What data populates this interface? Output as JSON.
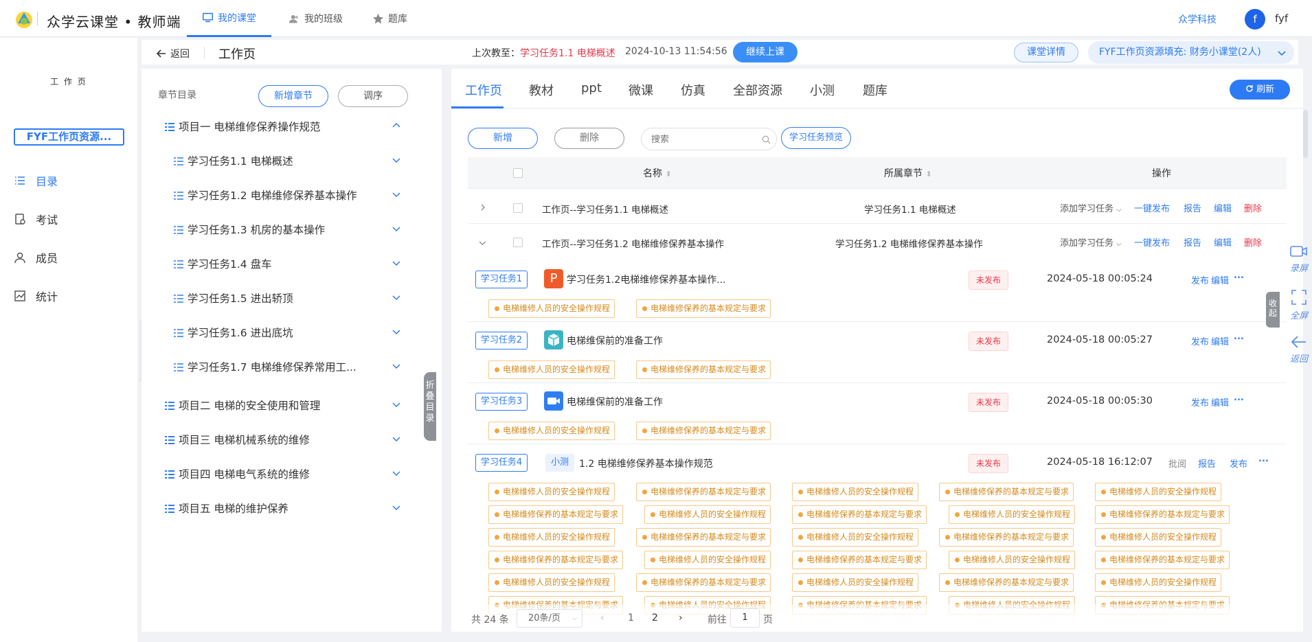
{
  "topbar": {
    "brand": "众学云课堂 • 教师端",
    "nav": [
      "我的课堂",
      "我的班级",
      "题库"
    ],
    "company_link": "众学科技",
    "avatar_letter": "f",
    "username": "fyf"
  },
  "leftnav": {
    "cover_text": "工 作 页",
    "course_name": "FYF工作页资源...",
    "items": [
      "目录",
      "考试",
      "成员",
      "统计"
    ]
  },
  "subheader": {
    "back_label": "返回",
    "page_title": "工作页",
    "last_taught_prefix": "上次教至：",
    "last_taught_task": "学习任务1.1 电梯概述",
    "last_taught_time": "2024-10-13 11:54:56",
    "continue_button": "继续上课",
    "class_detail_button": "课堂详情",
    "course_select": "FYF工作页资源填充:   财务小课堂(2人)"
  },
  "toc": {
    "title": "章节目录",
    "add_chapter": "新增章节",
    "reorder": "调序",
    "collapse_label": "折叠目录",
    "items": [
      {
        "label": "项目一 电梯维修保养操作规范",
        "level": 1,
        "expanded": true
      },
      {
        "label": "学习任务1.1 电梯概述",
        "level": 2
      },
      {
        "label": "学习任务1.2 电梯维修保养基本操作",
        "level": 2
      },
      {
        "label": "学习任务1.3 机房的基本操作",
        "level": 2
      },
      {
        "label": "学习任务1.4 盘车",
        "level": 2
      },
      {
        "label": "学习任务1.5 进出轿顶",
        "level": 2
      },
      {
        "label": "学习任务1.6 进出底坑",
        "level": 2
      },
      {
        "label": "学习任务1.7 电梯维修保养常用工...",
        "level": 2
      },
      {
        "label": "项目二 电梯的安全使用和管理",
        "level": 1
      },
      {
        "label": "项目三 电梯机械系统的维修",
        "level": 1
      },
      {
        "label": "项目四 电梯电气系统的维修",
        "level": 1
      },
      {
        "label": "项目五 电梯的维护保养",
        "level": 1
      }
    ]
  },
  "tabs": [
    "工作页",
    "教材",
    "ppt",
    "微课",
    "仿真",
    "全部资源",
    "小测",
    "题库"
  ],
  "refresh_button": "刷新",
  "toolbar": {
    "add": "新增",
    "delete": "删除",
    "search_placeholder": "搜索",
    "preview": "学习任务预览"
  },
  "table": {
    "headers": {
      "name": "名称",
      "chapter": "所属章节",
      "ops": "操作"
    },
    "rows": [
      {
        "name": "工作页--学习任务1.1 电梯概述",
        "chapter": "学习任务1.1 电梯概述",
        "add_task": "添加学习任务",
        "publish_all": "一键发布",
        "report": "报告",
        "edit": "编辑",
        "delete": "删除"
      },
      {
        "name": "工作页--学习任务1.2 电梯维修保养基本操作",
        "chapter": "学习任务1.2 电梯维修保养基本操作",
        "add_task": "添加学习任务",
        "publish_all": "一键发布",
        "report": "报告",
        "edit": "编辑",
        "delete": "删除"
      }
    ]
  },
  "tasks": [
    {
      "badge": "学习任务1",
      "title": "学习任务1.2电梯维修保养基本操作...",
      "icon": "ppt-icon",
      "status": "未发布",
      "time": "2024-05-18 00:05:24",
      "ops": [
        "发布",
        "编辑",
        "..."
      ],
      "tags": [
        "电梯维修人员的安全操作规程",
        "电梯维修保养的基本规定与要求"
      ]
    },
    {
      "badge": "学习任务2",
      "title": "电梯维保前的准备工作",
      "icon": "cube-icon",
      "status": "未发布",
      "time": "2024-05-18 00:05:27",
      "ops": [
        "发布",
        "编辑",
        "..."
      ],
      "tags": [
        "电梯维修人员的安全操作规程",
        "电梯维修保养的基本规定与要求"
      ]
    },
    {
      "badge": "学习任务3",
      "title": "电梯维保前的准备工作",
      "icon": "video-icon",
      "status": "未发布",
      "time": "2024-05-18 00:05:30",
      "ops": [
        "发布",
        "编辑",
        "..."
      ],
      "tags": [
        "电梯维修人员的安全操作规程",
        "电梯维修保养的基本规定与要求"
      ]
    },
    {
      "badge": "学习任务4",
      "quiz_label": "小测",
      "title": "1.2 电梯维修保养基本操作规范",
      "status": "未发布",
      "time": "2024-05-18 16:12:07",
      "ops": [
        "批阅",
        "报告",
        "发布",
        "..."
      ]
    }
  ],
  "tag_texts": {
    "a": "电梯维修人员的安全操作规程",
    "b": "电梯维修保养的基本规定与要求"
  },
  "pager": {
    "total": "共 24 条",
    "page_size": "20条/页",
    "pages": [
      "1",
      "2"
    ],
    "goto_label": "前往",
    "goto_value": "1",
    "page_unit": "页"
  },
  "right_tools": {
    "record": "录屏",
    "fullscreen": "全屏",
    "back": "返回",
    "collapse": "收起"
  }
}
